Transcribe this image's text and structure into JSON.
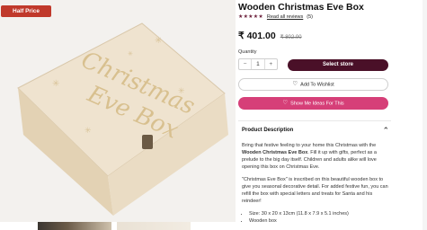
{
  "badge": "Half Price",
  "product": {
    "title": "Wooden Christmas Eve Box",
    "stars": "★★★★★",
    "reviews_link": "Read all reviews",
    "reviews_count": "(5)",
    "price": "₹ 401.00",
    "old_price": "₹ 802.00",
    "image_text_line1": "Christmas",
    "image_text_line2": "Eve Box"
  },
  "quantity": {
    "label": "Quantity",
    "minus": "−",
    "value": "1",
    "plus": "+"
  },
  "buttons": {
    "select_store": "Select store",
    "wishlist": "Add To Wishlist",
    "ideas": "Show Me Ideas For This"
  },
  "description": {
    "header": "Product Description",
    "para1_before": "Bring that festive feeling to your home this Christmas with the ",
    "para1_bold": "Wooden Christmas Eve Box",
    "para1_after": ". Fill it up with gifts, perfect as a prelude to the big day itself. Children and adults alike will love opening this box on Christmas Eve.",
    "para2": "\"Christmas Eve Box\" is inscribed on this beautiful wooden box to give you seasonal decorative detail. For added festive fun, you can refill the box with special letters and treats for Santa and his reindeer!",
    "bullets": [
      "Size: 30 x 20 x 13cm (11.8 x 7.9 x 5.1 inches)",
      "Wooden box"
    ]
  },
  "colors": {
    "badge": "#c0392b",
    "store_button": "#4a1028",
    "ideas_button": "#d63f78",
    "stars": "#6b1f3a"
  },
  "icons": [
    "heart-icon",
    "gift-icon",
    "chevron-up-icon",
    "star-icon",
    "latch-icon"
  ]
}
